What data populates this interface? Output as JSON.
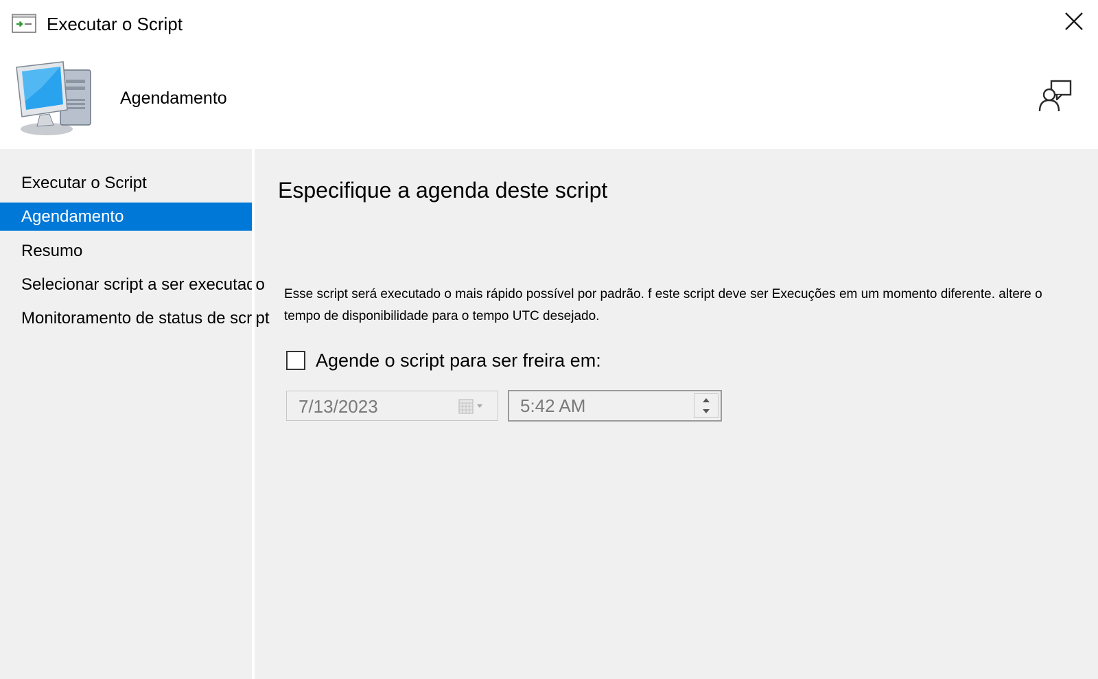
{
  "window": {
    "title": "Executar o Script",
    "icon": "script-run-icon",
    "close_icon": "close-icon"
  },
  "header": {
    "title": "Agendamento",
    "icon": "computer-icon",
    "feedback_icon": "feedback-icon"
  },
  "sidebar": {
    "items": [
      {
        "label": "Executar o Script",
        "active": false
      },
      {
        "label": "Agendamento",
        "active": true
      },
      {
        "label": "Resumo",
        "active": false
      },
      {
        "label": "Selecionar script a ser executado",
        "active": false
      },
      {
        "label": "Monitoramento de status de script",
        "active": false
      }
    ]
  },
  "main": {
    "heading": "Especifique a agenda deste script",
    "description": "Esse script será executado o mais rápido possível por padrão. f este script deve ser Execuções em um momento diferente. altere o tempo de disponibilidade para o tempo UTC desejado.",
    "schedule_checkbox": {
      "label": "Agende o script para ser freira em:",
      "checked": false
    },
    "date": {
      "value": "7/13/2023",
      "icon": "calendar-dropdown-icon"
    },
    "time": {
      "value": "5:42 AM",
      "icon": "spinner-icon"
    }
  },
  "colors": {
    "accent": "#0078d7",
    "background": "#f0f0f0",
    "header_background": "#ffffff",
    "disabled_text": "#7a7a7a"
  }
}
